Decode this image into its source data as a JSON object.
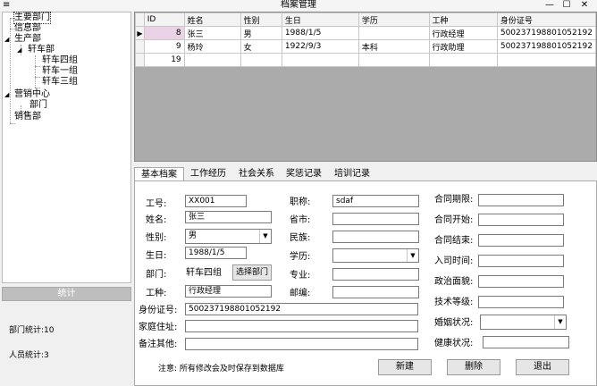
{
  "window": {
    "title": "档案管理",
    "sysmenu_icon": "≡",
    "minimize": "—",
    "maximize": "☐"
  },
  "tree": {
    "nodes": [
      {
        "label": "主要部门",
        "expander": ""
      },
      {
        "label": "信息部",
        "expander": ""
      },
      {
        "label": "生产部",
        "expander": "◢"
      },
      {
        "label": "轩车部",
        "expander": "◢"
      },
      {
        "label": "轩车四组",
        "expander": ""
      },
      {
        "label": "轩车一组",
        "expander": ""
      },
      {
        "label": "轩车三组",
        "expander": ""
      },
      {
        "label": "营销中心",
        "expander": "◢"
      },
      {
        "label": "部门",
        "expander": ""
      },
      {
        "label": "销售部",
        "expander": ""
      }
    ]
  },
  "stats": {
    "header": "统计",
    "dept_count": "部门统计:10",
    "person_count": "人员统计:3"
  },
  "grid": {
    "columns": [
      "ID",
      "姓名",
      "性别",
      "生日",
      "学历",
      "工种",
      "身份证号"
    ],
    "rows": [
      {
        "indicator": "▶",
        "cells": [
          "8",
          "张三",
          "男",
          "1988/1/5",
          "",
          "行政经理",
          "500237198801052192"
        ]
      },
      {
        "indicator": "",
        "cells": [
          "9",
          "杨玲",
          "女",
          "1922/9/3",
          "本科",
          "行政助理",
          "500237198801052192"
        ]
      },
      {
        "indicator": "",
        "cells": [
          "19",
          "",
          "",
          "",
          "",
          "",
          ""
        ]
      }
    ]
  },
  "tabs": [
    "基本档案",
    "工作经历",
    "社会关系",
    "奖惩记录",
    "培训记录"
  ],
  "form": {
    "job_no_label": "工号:",
    "job_no": "XX001",
    "name_label": "姓名:",
    "name": "张三",
    "gender_label": "性别:",
    "gender": "男",
    "birthday_label": "生日:",
    "birthday": "1988/1/5",
    "dept_label": "部门:",
    "dept": "轩车四组",
    "select_dept": "选择部门",
    "job_type_label": "工种:",
    "job_type": "行政经理",
    "id_label": "身份证号:",
    "id_no": "500237198801052192",
    "address_label": "家庭住址:",
    "address": "",
    "remark_label": "备注其他:",
    "remark": "",
    "title_label": "职称:",
    "title": "sdaf",
    "province_label": "省市:",
    "province": "",
    "ethnic_label": "民族:",
    "ethnic": "",
    "education_label": "学历:",
    "education": "",
    "major_label": "专业:",
    "major": "",
    "postcode_label": "邮编:",
    "postcode": "",
    "contract_term_label": "合同期限:",
    "contract_term": "",
    "contract_start_label": "合同开始:",
    "contract_start": "",
    "contract_end_label": "合同结束:",
    "contract_end": "",
    "hire_date_label": "入司时间:",
    "hire_date": "",
    "political_label": "政治面貌:",
    "political": "",
    "skill_label": "技术等级:",
    "skill": "",
    "marital_label": "婚姻状况:",
    "marital": "",
    "health_label": "健康状况:",
    "health": ""
  },
  "note": "注意:  所有修改会及时保存到数据库",
  "buttons": {
    "new": "新建",
    "delete": "删除",
    "exit": "退出"
  }
}
